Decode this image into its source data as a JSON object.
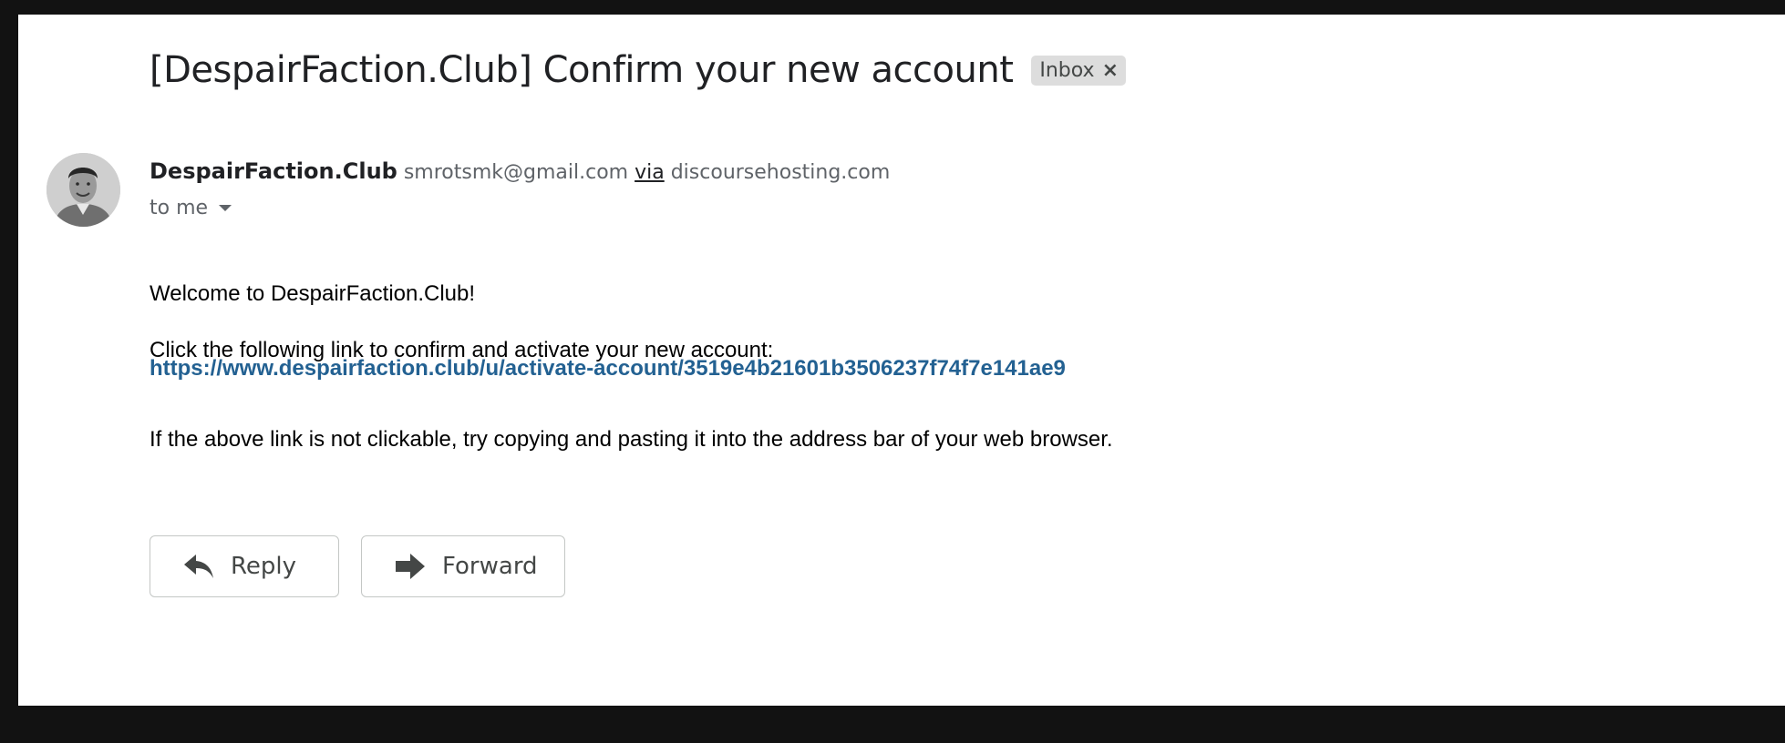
{
  "email": {
    "subject": "[DespairFaction.Club] Confirm your new account",
    "label": "Inbox",
    "label_remove_icon": "close-icon",
    "sender": {
      "name": "DespairFaction.Club",
      "email": "smrotsmk@gmail.com",
      "via_label": "via",
      "via_domain": "discoursehosting.com",
      "avatar_icon": "person-avatar"
    },
    "recipient": "to me",
    "recipient_toggle_icon": "caret-down-icon",
    "body": {
      "greeting": "Welcome to DespairFaction.Club!",
      "instruction": "Click the following link to confirm and activate your new account:",
      "link": "https://www.despairfaction.club/u/activate-account/3519e4b21601b3506237f74f7e141ae9",
      "note": "If the above link is not clickable, try copying and pasting it into the address bar of your web browser."
    }
  },
  "actions": {
    "reply_label": "Reply",
    "reply_icon": "reply-arrow-icon",
    "forward_label": "Forward",
    "forward_icon": "forward-arrow-icon"
  },
  "colors": {
    "page_frame": "#121212",
    "panel": "#ffffff",
    "link": "#236192",
    "chip": "#dddddd",
    "text_primary": "#202124",
    "text_secondary": "#5f6368"
  }
}
